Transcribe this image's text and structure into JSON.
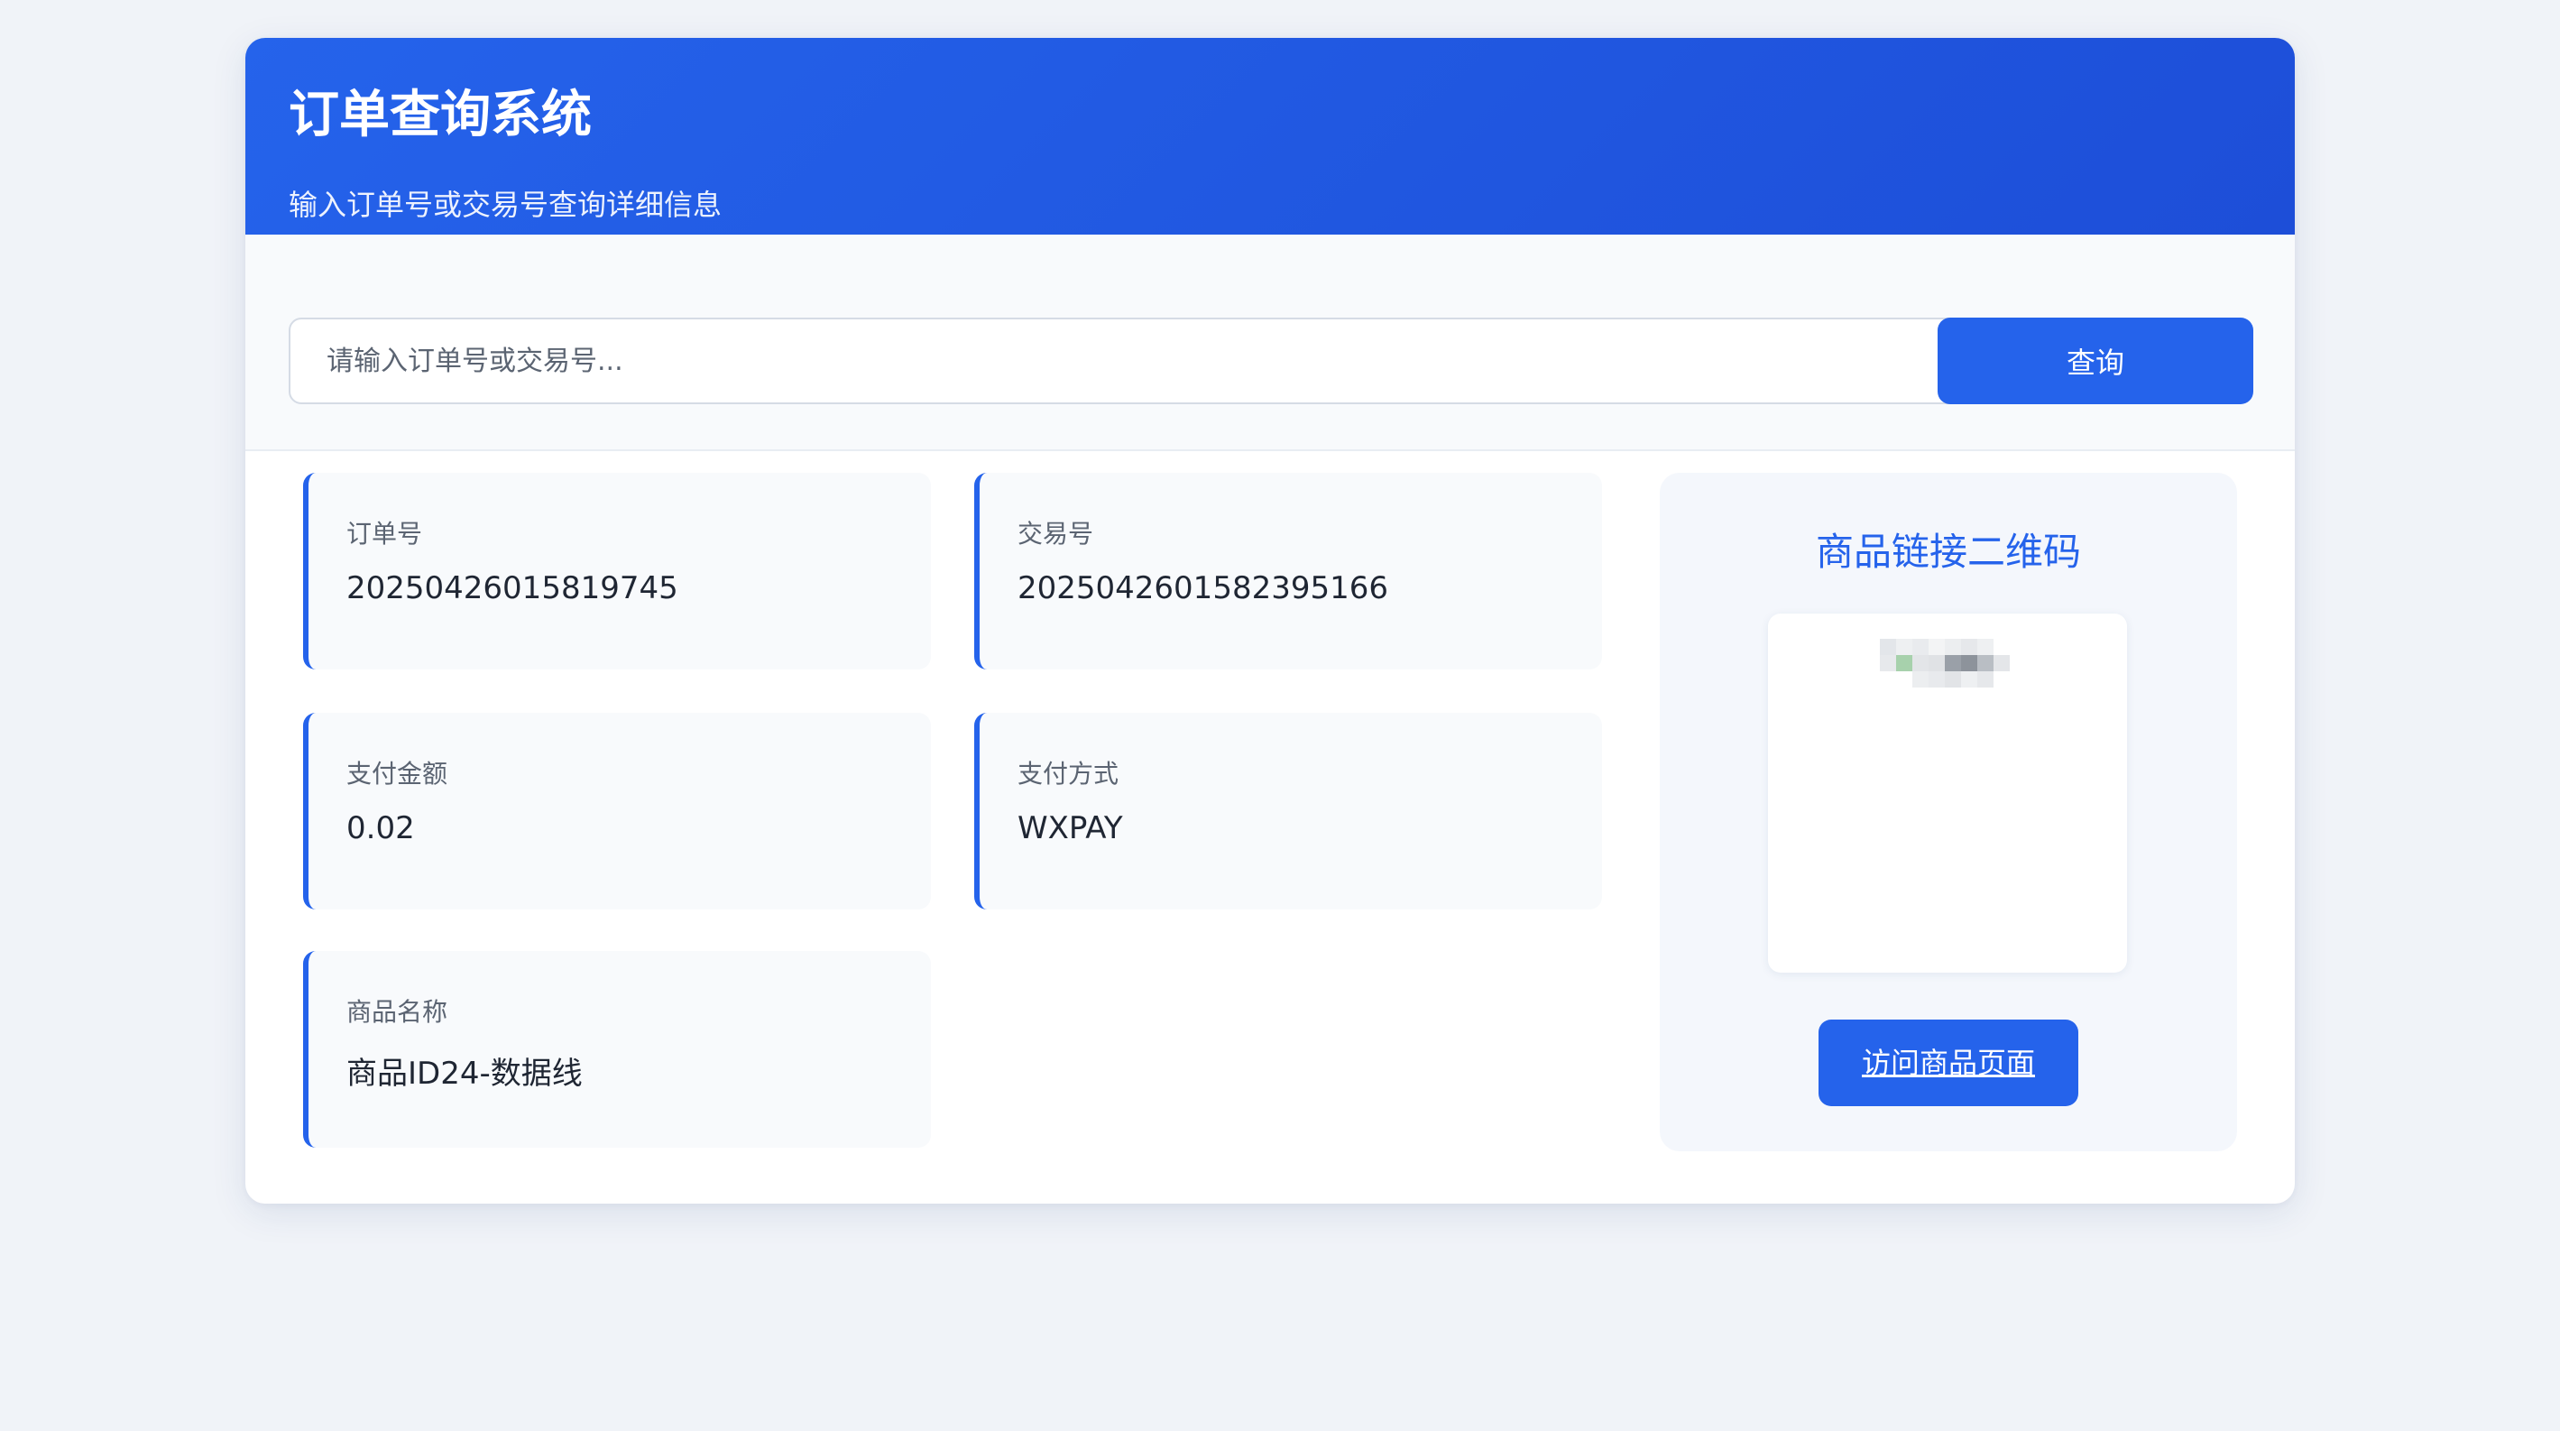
{
  "header": {
    "title": "订单查询系统",
    "subtitle": "输入订单号或交易号查询详细信息"
  },
  "search": {
    "placeholder": "请输入订单号或交易号...",
    "value": "",
    "button_label": "查询"
  },
  "order": {
    "fields": [
      {
        "label": "订单号",
        "value": "20250426015819745"
      },
      {
        "label": "交易号",
        "value": "2025042601582395166"
      },
      {
        "label": "支付金额",
        "value": "0.02"
      },
      {
        "label": "支付方式",
        "value": "WXPAY"
      },
      {
        "label": "商品名称",
        "value": "商品ID24-数据线"
      }
    ]
  },
  "qr": {
    "title": "商品链接二维码",
    "icon": "qr-code-icon",
    "visit_label": "访问商品页面"
  },
  "colors": {
    "accent": "#2563eb",
    "accent_dark": "#1d4ed8",
    "background": "#f0f3f8",
    "panel": "#f8fafc"
  }
}
